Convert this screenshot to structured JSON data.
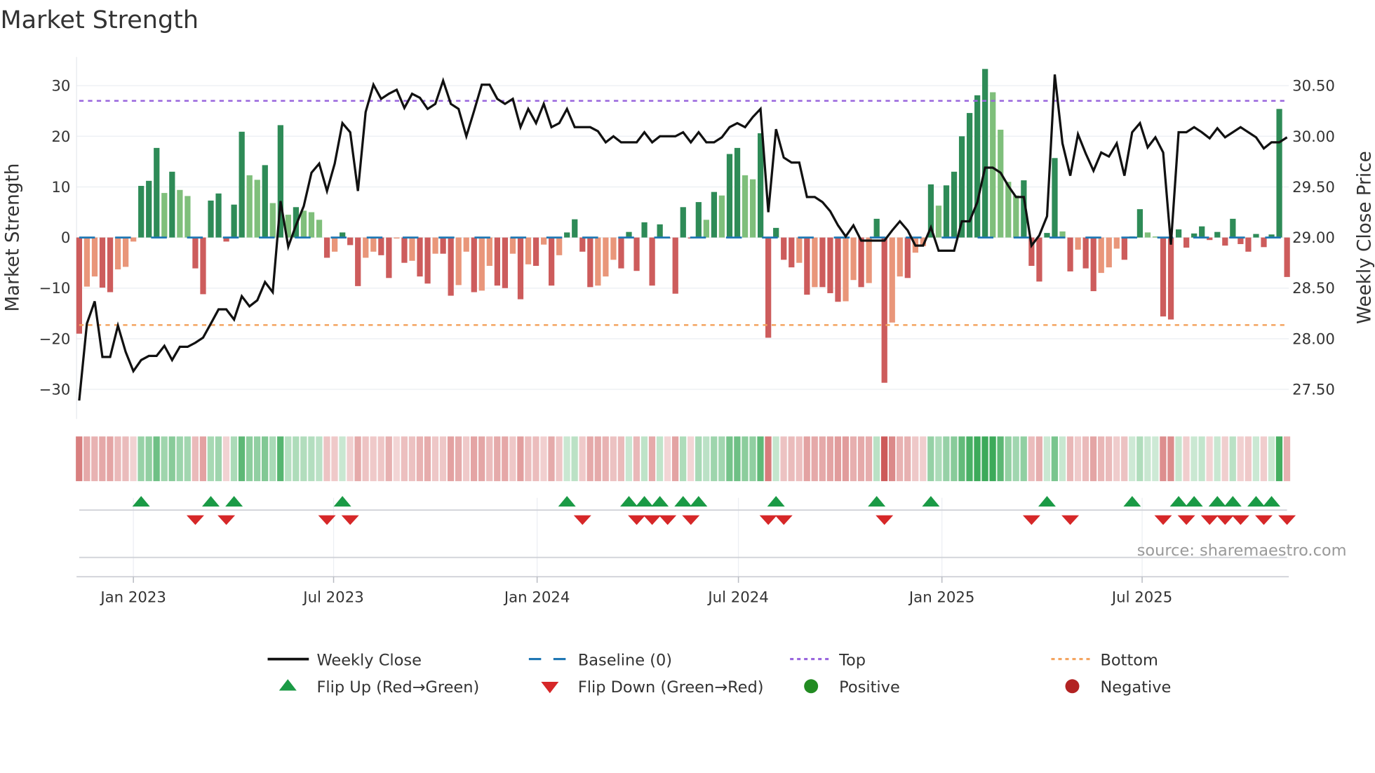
{
  "chart_data": {
    "type": "bar+line",
    "title": "Market Strength",
    "ylabel": "Market Strength",
    "y2label": "Weekly Close Price",
    "ylim": [
      -35,
      36
    ],
    "y2lim": [
      27.3,
      30.85
    ],
    "yticks": [
      30,
      20,
      10,
      0,
      -10,
      -20,
      -30
    ],
    "yticklabels": [
      "30",
      "20",
      "10",
      "0",
      "−10",
      "−20",
      "−30"
    ],
    "y2ticks": [
      30.5,
      30.0,
      29.5,
      29.0,
      28.5,
      28.0,
      27.5
    ],
    "y2ticklabels": [
      "30.50",
      "30.00",
      "29.50",
      "29.00",
      "28.50",
      "28.00",
      "27.50"
    ],
    "x_start": "2022-11-13",
    "x_interval": "weekly",
    "xticks": [
      {
        "date": "2023-01-01",
        "label": "Jan 2023"
      },
      {
        "date": "2023-07-01",
        "label": "Jul 2023"
      },
      {
        "date": "2024-01-01",
        "label": "Jan 2024"
      },
      {
        "date": "2024-07-01",
        "label": "Jul 2024"
      },
      {
        "date": "2025-01-01",
        "label": "Jan 2025"
      },
      {
        "date": "2025-07-01",
        "label": "Jul 2025"
      }
    ],
    "top_level": 27.0,
    "bottom_level": -17.3,
    "baseline": 0,
    "strength": [
      -19,
      -9.7,
      -7.7,
      -9.9,
      -10.8,
      -6.3,
      -5.8,
      -0.8,
      10.2,
      11.2,
      17.7,
      8.8,
      13,
      9.4,
      8.2,
      -6.1,
      -11.2,
      7.3,
      8.7,
      -0.8,
      6.5,
      20.9,
      12.3,
      11.4,
      14.3,
      6.8,
      22.2,
      4.5,
      6.0,
      5.3,
      5.0,
      3.5,
      -4.0,
      -2.8,
      1.0,
      -1.5,
      -9.6,
      -4.0,
      -2.8,
      -3.5,
      -8.0,
      -0.2,
      -5.0,
      -4.6,
      -7.7,
      -9.1,
      -3.2,
      -3.2,
      -11.5,
      -9.4,
      -2.8,
      -10.8,
      -10.5,
      -5.6,
      -9.5,
      -10.0,
      -3.2,
      -12.2,
      -5.3,
      -5.6,
      -1.4,
      -9.5,
      -3.5,
      1.0,
      3.6,
      -2.8,
      -9.8,
      -9.5,
      -7.7,
      -4.4,
      -6.1,
      1.1,
      -6.6,
      3.0,
      -9.5,
      2.6,
      -0.2,
      -11.1,
      6.0,
      -0.2,
      7.0,
      3.5,
      9.0,
      8.3,
      16.5,
      17.7,
      12.3,
      11.5,
      20.6,
      -19.8,
      1.9,
      -4.4,
      -5.9,
      -5.0,
      -11.3,
      -9.8,
      -9.8,
      -11,
      -12.7,
      -12.6,
      -8.4,
      -9.8,
      -9.0,
      3.7,
      -28.7,
      -16.8,
      -7.7,
      -8.0,
      -3.0,
      -1.7,
      10.5,
      6.3,
      10.3,
      13,
      20,
      24.6,
      28.1,
      33.3,
      28.7,
      21.3,
      11,
      8.3,
      11.3,
      -5.6,
      -8.7,
      0.9,
      15.7,
      1.2,
      -6.7,
      -2.4,
      -6.1,
      -10.6,
      -7.0,
      -5.9,
      -2.2,
      -4.4,
      0.2,
      5.6,
      1.0,
      0.2,
      -15.6,
      -16.2,
      1.6,
      -2.0,
      0.8,
      2.2,
      -0.5,
      1.1,
      -1.6,
      3.7,
      -1.3,
      -2.8,
      0.7,
      -1.9,
      0.6,
      25.4,
      -7.8
    ],
    "weekly_close": [
      27.39,
      28.15,
      28.37,
      27.82,
      27.82,
      28.13,
      27.87,
      27.68,
      27.79,
      27.83,
      27.83,
      27.93,
      27.79,
      27.92,
      27.92,
      27.96,
      28.01,
      28.15,
      28.29,
      28.29,
      28.19,
      28.42,
      28.32,
      28.38,
      28.56,
      28.46,
      29.36,
      28.91,
      29.12,
      29.31,
      29.64,
      29.73,
      29.46,
      29.73,
      30.13,
      30.04,
      29.46,
      30.24,
      30.51,
      30.37,
      30.42,
      30.46,
      30.28,
      30.42,
      30.38,
      30.27,
      30.32,
      30.55,
      30.32,
      30.27,
      30.0,
      30.25,
      30.51,
      30.51,
      30.37,
      30.32,
      30.37,
      30.09,
      30.27,
      30.13,
      30.32,
      30.09,
      30.13,
      30.27,
      30.09,
      30.09,
      30.09,
      30.05,
      29.94,
      30.0,
      29.94,
      29.94,
      29.94,
      30.04,
      29.94,
      30.0,
      30.0,
      30.0,
      30.04,
      29.94,
      30.04,
      29.94,
      29.94,
      29.99,
      30.09,
      30.13,
      30.09,
      30.19,
      30.27,
      29.25,
      30.07,
      29.79,
      29.74,
      29.74,
      29.4,
      29.4,
      29.35,
      29.26,
      29.12,
      29.01,
      29.12,
      28.97,
      28.97,
      28.97,
      28.97,
      29.07,
      29.16,
      29.07,
      28.92,
      28.92,
      29.1,
      28.87,
      28.87,
      28.87,
      29.16,
      29.16,
      29.35,
      29.69,
      29.69,
      29.64,
      29.51,
      29.4,
      29.4,
      28.92,
      29.02,
      29.21,
      30.61,
      29.93,
      29.61,
      30.02,
      29.83,
      29.66,
      29.84,
      29.8,
      29.93,
      29.61,
      30.04,
      30.13,
      29.89,
      29.99,
      29.84,
      28.93,
      30.04,
      30.04,
      30.09,
      30.04,
      29.98,
      30.08,
      29.99,
      30.04,
      30.09,
      30.04,
      29.99,
      29.88,
      29.94,
      29.94,
      29.99
    ],
    "legend": {
      "placement": "bottom",
      "items": [
        {
          "label": "Weekly Close",
          "kind": "line"
        },
        {
          "label": "Baseline (0)",
          "kind": "dash"
        },
        {
          "label": "Top",
          "kind": "dot-purple"
        },
        {
          "label": "Bottom",
          "kind": "dot-orange"
        },
        {
          "label": "Flip Up (Red→Green)",
          "kind": "tri-up"
        },
        {
          "label": "Flip Down (Green→Red)",
          "kind": "tri-down"
        },
        {
          "label": "Positive",
          "kind": "circle-green"
        },
        {
          "label": "Negative",
          "kind": "circle-red"
        }
      ]
    },
    "source": "source: sharemaestro.com",
    "colors": {
      "pos_strong": "#2e8b57",
      "pos_weak": "#7fbf7b",
      "neg_strong": "#cd5c5c",
      "neg_weak": "#e9967a",
      "line": "#111111",
      "baseline": "#1f77b4",
      "top": "#9966dd",
      "bottom": "#f4a460",
      "flip_up": "#1a9a45",
      "flip_down": "#d62728",
      "positive": "#228b22",
      "negative": "#b22222"
    }
  }
}
